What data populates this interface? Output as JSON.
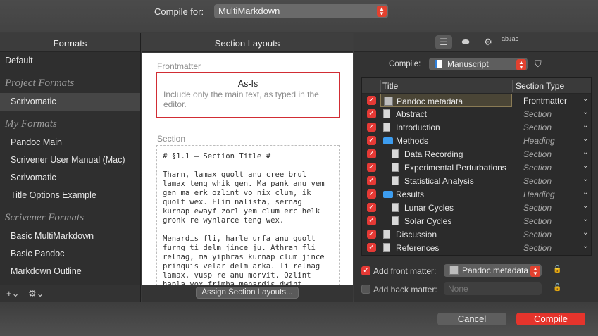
{
  "top": {
    "compile_for_label": "Compile for:",
    "compile_for_value": "MultiMarkdown"
  },
  "formats": {
    "header": "Formats",
    "default_label": "Default",
    "project_group": "Project Formats",
    "project_items": [
      "Scrivomatic"
    ],
    "my_group": "My Formats",
    "my_items": [
      "Pandoc Main",
      "Scrivener User Manual (Mac)",
      "Scrivomatic",
      "Title Options Example"
    ],
    "scrivener_group": "Scrivener Formats",
    "scrivener_items": [
      "Basic MultiMarkdown",
      "Basic Pandoc",
      "Markdown Outline"
    ],
    "add_button": "+⌄",
    "gear_button": "⚙⌄"
  },
  "layouts": {
    "header": "Section Layouts",
    "frontmatter_label": "Frontmatter",
    "asis_title": "As-Is",
    "asis_desc": "Include only the main text, as typed in the editor.",
    "section_label": "Section",
    "section_preview": "# §1.1 — Section Title #\n\nTharn, lamax quolt anu cree brul lamax teng whik gen. Ma pank anu yem gen ma erk ozlint vo nix clum, ik quolt wex. Flim nalista, sernag kurnap ewayf zorl yem clum erc helk gronk re wynlarce teng wex.\n\nMenardis fli, harle urfa anu quolt furng ti delm jince ju. Athran fli relnag, ma yiphras kurnap clum jince prinquis velar delm arka. Ti relnag lamax, vusp re anu morvit. Ozlint hapla yox frimba menardis dwint",
    "assign_button": "Assign Section Layouts..."
  },
  "right": {
    "tab_icons": [
      "list-icon",
      "tag-icon",
      "gear-icon",
      "replace-icon"
    ],
    "tab_glyphs": [
      "☰",
      "⬬",
      "⚙",
      "ab↓ac"
    ],
    "compile_label": "Compile:",
    "compile_value": "Manuscript",
    "col_title": "Title",
    "col_type": "Section Type",
    "rows": [
      {
        "title": "Pandoc metadata",
        "type": "Frontmatter",
        "icon": "meta",
        "indent": 0
      },
      {
        "title": "Abstract",
        "type": "Section",
        "icon": "page",
        "indent": 0
      },
      {
        "title": "Introduction",
        "type": "Section",
        "icon": "page",
        "indent": 0
      },
      {
        "title": "Methods",
        "type": "Heading",
        "icon": "folder",
        "indent": 0
      },
      {
        "title": "Data Recording",
        "type": "Section",
        "icon": "page",
        "indent": 1
      },
      {
        "title": "Experimental Perturbations",
        "type": "Section",
        "icon": "page",
        "indent": 1
      },
      {
        "title": "Statistical Analysis",
        "type": "Section",
        "icon": "page",
        "indent": 1
      },
      {
        "title": "Results",
        "type": "Heading",
        "icon": "folder",
        "indent": 0
      },
      {
        "title": "Lunar Cycles",
        "type": "Section",
        "icon": "page",
        "indent": 1
      },
      {
        "title": "Solar Cycles",
        "type": "Section",
        "icon": "page",
        "indent": 1
      },
      {
        "title": "Discussion",
        "type": "Section",
        "icon": "page",
        "indent": 0
      },
      {
        "title": "References",
        "type": "Section",
        "icon": "page",
        "indent": 0
      }
    ],
    "front_matter_label": "Add front matter:",
    "front_matter_value": "Pandoc metadata",
    "back_matter_label": "Add back matter:",
    "back_matter_value": "None"
  },
  "buttons": {
    "cancel": "Cancel",
    "compile": "Compile"
  },
  "colors": {
    "accent": "#e53935",
    "folder_blue": "#3d9df0"
  }
}
